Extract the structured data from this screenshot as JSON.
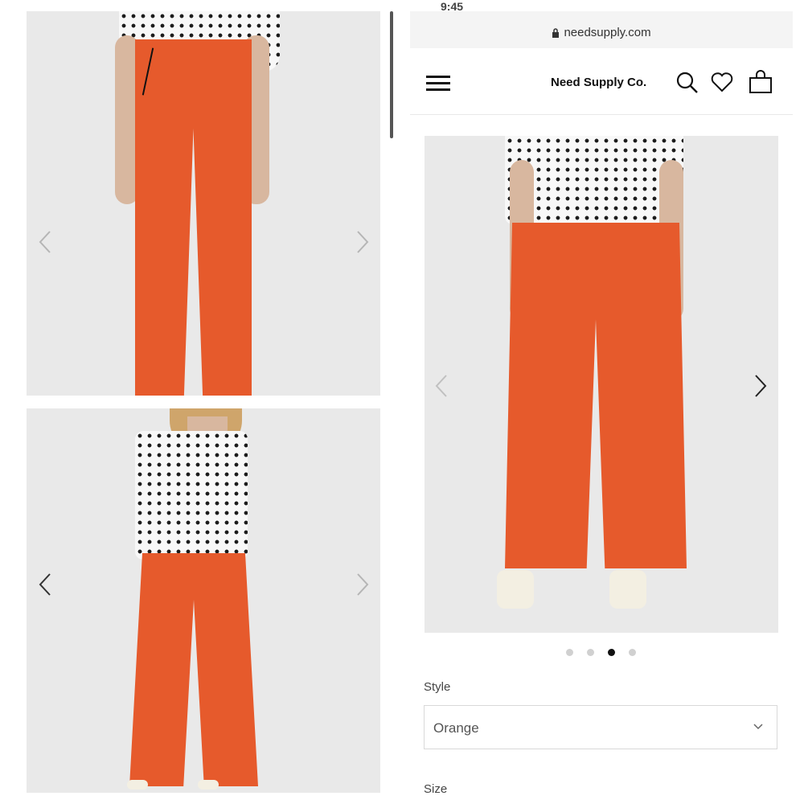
{
  "browser": {
    "status_time": "9:45",
    "url": "needsupply.com",
    "lock_icon": "lock-icon"
  },
  "header": {
    "menu_icon": "hamburger-menu-icon",
    "brand": "Need Supply Co.",
    "icons": [
      "search-icon",
      "heart-icon",
      "shopping-bag-icon"
    ]
  },
  "gallery": {
    "left_images": [
      "product-photo-pants-front",
      "product-photo-full-outfit"
    ],
    "main_image": "product-photo-back-view",
    "dots_count": 4,
    "active_dot": 3,
    "prev_icon": "chevron-left-icon",
    "next_icon": "chevron-right-icon"
  },
  "product": {
    "style_label": "Style",
    "style_value": "Orange",
    "size_label": "Size"
  },
  "colors": {
    "pants": "#e65a2c",
    "photo_bg": "#e9e9e9",
    "active_dot": "#111111",
    "inactive_dot": "#d0d0d0"
  }
}
